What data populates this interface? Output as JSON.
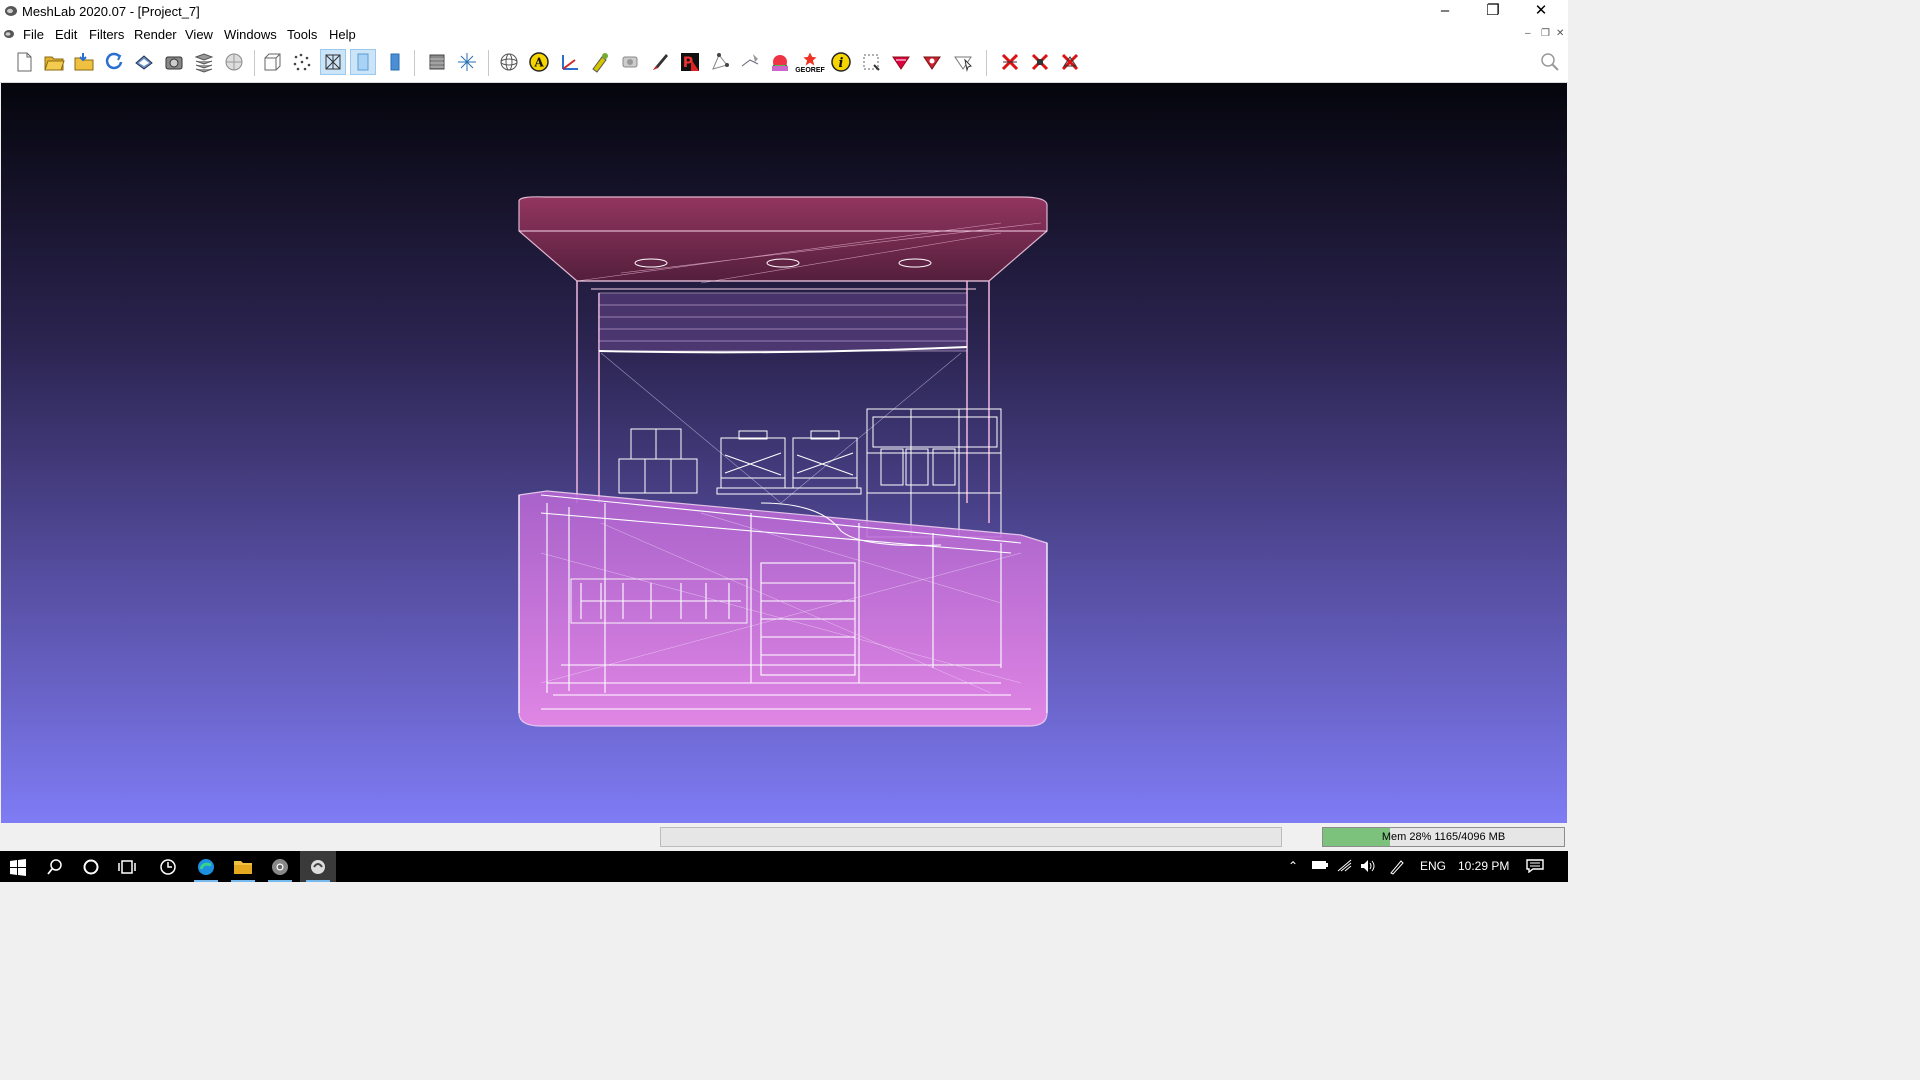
{
  "window": {
    "title": "MeshLab 2020.07 - [Project_7]",
    "minimize_icon": "minimize-icon",
    "restore_icon": "restore-icon",
    "close_icon": "close-icon"
  },
  "menu": {
    "file": "File",
    "edit": "Edit",
    "filters": "Filters",
    "render": "Render",
    "view": "View",
    "windows": "Windows",
    "tools": "Tools",
    "help": "Help"
  },
  "toolbar": {
    "georef_label": "GEOREF",
    "paint_letter": "P",
    "annotate_letter": "A",
    "info_letter": "i",
    "buttons": [
      "new-project-icon",
      "open-project-icon",
      "import-mesh-icon",
      "reload-icon",
      "export-mesh-icon",
      "snapshot-icon",
      "layers-icon",
      "ambient-occlusion-icon",
      "bounding-box-icon",
      "points-icon",
      "wireframe-icon",
      "flat-lines-icon",
      "smooth-icon",
      "lighting-icon",
      "axis-icon",
      "trackball-icon",
      "annotation-icon",
      "measure-icon",
      "align-icon",
      "raster-camera-icon",
      "paint-icon",
      "z-painting-icon",
      "pick-points-icon",
      "manipulator-icon",
      "texture-icon",
      "georef-icon",
      "info-icon",
      "select-faces-icon",
      "select-vertices-icon",
      "select-connected-icon",
      "select-pointer-icon",
      "delete-faces-icon",
      "delete-vertices-icon",
      "delete-all-icon",
      "search-icon"
    ],
    "active": [
      "wireframe-icon",
      "flat-lines-icon"
    ]
  },
  "statusbar": {
    "memory_text": "Mem 28% 1165/4096 MB",
    "memory_fraction": 0.28
  },
  "taskbar": {
    "apps": [
      "start-icon",
      "search-icon",
      "cortana-icon",
      "task-view-icon",
      "timeline-icon",
      "edge-icon",
      "file-explorer-icon",
      "chrome-icon",
      "meshlab-icon"
    ],
    "language": "ENG",
    "time": "10:29 PM"
  },
  "colors": {
    "viewport_top": "#05050c",
    "viewport_bottom": "#7f7cf5",
    "mesh_roof": "#8a2d50",
    "mesh_base": "#d67ae0",
    "accent": "#76b9ed"
  }
}
